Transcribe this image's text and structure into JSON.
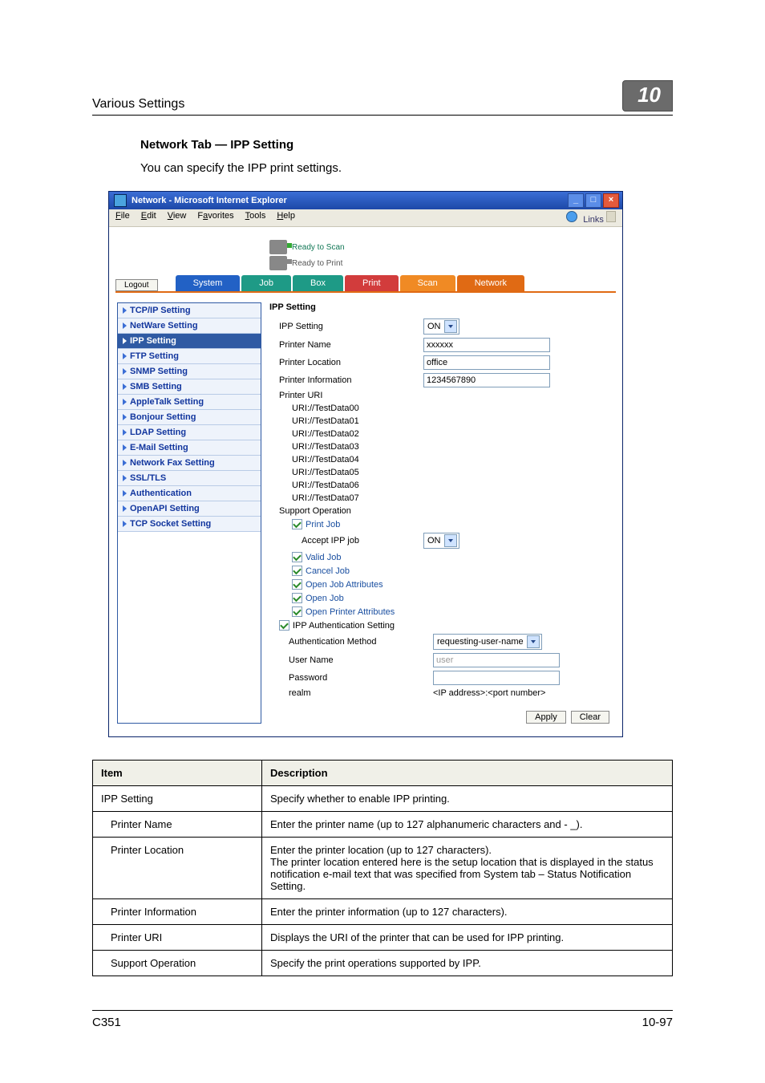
{
  "header": {
    "title": "Various Settings",
    "chapter": "10"
  },
  "section": {
    "heading": "Network Tab — IPP Setting",
    "body": "You can specify the IPP print settings."
  },
  "window": {
    "title": "Network - Microsoft Internet Explorer",
    "menus": {
      "file": "File",
      "edit": "Edit",
      "view": "View",
      "favorites": "Favorites",
      "tools": "Tools",
      "help": "Help",
      "links": "Links"
    },
    "status": {
      "scan": "Ready to Scan",
      "print": "Ready to Print"
    },
    "logout": "Logout",
    "tabs": {
      "system": "System",
      "job": "Job",
      "box": "Box",
      "print": "Print",
      "scan": "Scan",
      "network": "Network"
    },
    "nav": {
      "tcpip": "TCP/IP Setting",
      "netware": "NetWare Setting",
      "ipp": "IPP Setting",
      "ftp": "FTP Setting",
      "snmp": "SNMP Setting",
      "smb": "SMB Setting",
      "appletalk": "AppleTalk Setting",
      "bonjour": "Bonjour Setting",
      "ldap": "LDAP Setting",
      "email": "E-Mail Setting",
      "netfax": "Network Fax Setting",
      "ssltls": "SSL/TLS",
      "auth": "Authentication",
      "openapi": "OpenAPI Setting",
      "tcpsocket": "TCP Socket Setting"
    },
    "form": {
      "heading": "IPP Setting",
      "ipp_setting_label": "IPP Setting",
      "ipp_setting_value": "ON",
      "printer_name_label": "Printer Name",
      "printer_name_value": "xxxxxx",
      "printer_location_label": "Printer Location",
      "printer_location_value": "office",
      "printer_info_label": "Printer Information",
      "printer_info_value": "1234567890",
      "printer_uri_label": "Printer URI",
      "uris": {
        "u0": "URI://TestData00",
        "u1": "URI://TestData01",
        "u2": "URI://TestData02",
        "u3": "URI://TestData03",
        "u4": "URI://TestData04",
        "u5": "URI://TestData05",
        "u6": "URI://TestData06",
        "u7": "URI://TestData07"
      },
      "support_op_label": "Support Operation",
      "ops": {
        "print_job": "Print Job",
        "accept_ipp": "Accept IPP job",
        "accept_ipp_value": "ON",
        "valid_job": "Valid Job",
        "cancel_job": "Cancel Job",
        "open_job_attr": "Open Job Attributes",
        "open_job": "Open Job",
        "open_printer_attr": "Open Printer Attributes"
      },
      "ipp_auth_label": "IPP Authentication Setting",
      "auth_method_label": "Authentication Method",
      "auth_method_value": "requesting-user-name",
      "user_name_label": "User Name",
      "user_name_value": "user",
      "password_label": "Password",
      "realm_label": "realm",
      "realm_value": "<IP address>:<port number>",
      "apply": "Apply",
      "clear": "Clear"
    }
  },
  "table": {
    "h_item": "Item",
    "h_desc": "Description",
    "rows": {
      "r0": {
        "item": "IPP Setting",
        "desc": "Specify whether to enable IPP printing."
      },
      "r1": {
        "item": "Printer Name",
        "desc": "Enter the printer name (up to 127 alphanumeric characters and - _)."
      },
      "r2": {
        "item": "Printer Location",
        "desc": "Enter the printer location (up to 127 characters).\nThe printer location entered here is the setup location that is displayed in the status notification e-mail text that was specified from System tab – Status Notification Setting."
      },
      "r3": {
        "item": "Printer Information",
        "desc": "Enter the printer information (up to 127 characters)."
      },
      "r4": {
        "item": "Printer URI",
        "desc": "Displays the URI of the printer that can be used for IPP printing."
      },
      "r5": {
        "item": "Support Operation",
        "desc": "Specify the print operations supported by IPP."
      }
    }
  },
  "footer": {
    "left": "C351",
    "right": "10-97"
  }
}
